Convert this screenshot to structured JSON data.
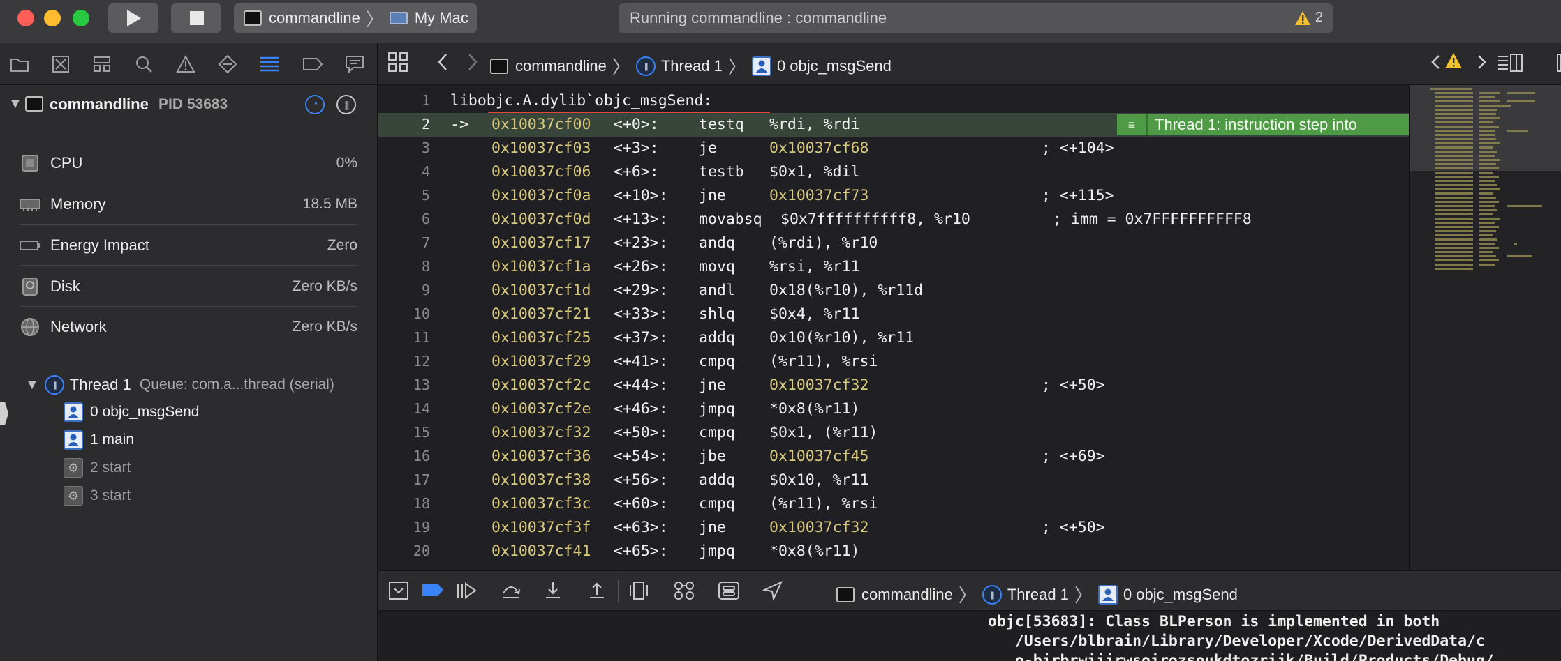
{
  "toolbar": {
    "scheme_target": "commandline",
    "scheme_device": "My Mac",
    "activity_text": "Running commandline : commandline",
    "warning_count": "2"
  },
  "navigator": {
    "process": {
      "name": "commandline",
      "pid": "PID 53683"
    },
    "gauges": [
      {
        "label": "CPU",
        "value": "0%",
        "icon": "cpu-icon"
      },
      {
        "label": "Memory",
        "value": "18.5 MB",
        "icon": "memory-icon"
      },
      {
        "label": "Energy Impact",
        "value": "Zero",
        "icon": "battery-icon"
      },
      {
        "label": "Disk",
        "value": "Zero KB/s",
        "icon": "disk-icon"
      },
      {
        "label": "Network",
        "value": "Zero KB/s",
        "icon": "network-icon"
      }
    ],
    "thread": {
      "name": "Thread 1",
      "queue": "Queue: com.a...thread (serial)"
    },
    "frames": [
      {
        "label": "0 objc_msgSend",
        "kind": "user"
      },
      {
        "label": "1 main",
        "kind": "user"
      },
      {
        "label": "2 start",
        "kind": "system"
      },
      {
        "label": "3 start",
        "kind": "system"
      }
    ]
  },
  "jumpbar": {
    "target": "commandline",
    "thread": "Thread 1",
    "frame": "0 objc_msgSend"
  },
  "editor": {
    "header_line": "libobjc.A.dylib`objc_msgSend:",
    "pc_arrow": "->",
    "breakpoint_message": "Thread 1: instruction step into",
    "lines": [
      {
        "n": "2",
        "addr": "0x10037cf00",
        "off": "<+0>:",
        "mn": "testq",
        "ops": "%rdi, %rdi",
        "comment": ""
      },
      {
        "n": "3",
        "addr": "0x10037cf03",
        "off": "<+3>:",
        "mn": "je",
        "ops": "0x10037cf68",
        "comment": "; <+104>"
      },
      {
        "n": "4",
        "addr": "0x10037cf06",
        "off": "<+6>:",
        "mn": "testb",
        "ops": "$0x1, %dil",
        "comment": ""
      },
      {
        "n": "5",
        "addr": "0x10037cf0a",
        "off": "<+10>:",
        "mn": "jne",
        "ops": "0x10037cf73",
        "comment": "; <+115>"
      },
      {
        "n": "6",
        "addr": "0x10037cf0d",
        "off": "<+13>:",
        "mn": "movabsq",
        "ops": "$0x7ffffffffff8, %r10",
        "comment": "; imm = 0x7FFFFFFFFFF8"
      },
      {
        "n": "7",
        "addr": "0x10037cf17",
        "off": "<+23>:",
        "mn": "andq",
        "ops": "(%rdi), %r10",
        "comment": ""
      },
      {
        "n": "8",
        "addr": "0x10037cf1a",
        "off": "<+26>:",
        "mn": "movq",
        "ops": "%rsi, %r11",
        "comment": ""
      },
      {
        "n": "9",
        "addr": "0x10037cf1d",
        "off": "<+29>:",
        "mn": "andl",
        "ops": "0x18(%r10), %r11d",
        "comment": ""
      },
      {
        "n": "10",
        "addr": "0x10037cf21",
        "off": "<+33>:",
        "mn": "shlq",
        "ops": "$0x4, %r11",
        "comment": ""
      },
      {
        "n": "11",
        "addr": "0x10037cf25",
        "off": "<+37>:",
        "mn": "addq",
        "ops": "0x10(%r10), %r11",
        "comment": ""
      },
      {
        "n": "12",
        "addr": "0x10037cf29",
        "off": "<+41>:",
        "mn": "cmpq",
        "ops": "(%r11), %rsi",
        "comment": ""
      },
      {
        "n": "13",
        "addr": "0x10037cf2c",
        "off": "<+44>:",
        "mn": "jne",
        "ops": "0x10037cf32",
        "comment": "; <+50>"
      },
      {
        "n": "14",
        "addr": "0x10037cf2e",
        "off": "<+46>:",
        "mn": "jmpq",
        "ops": "*0x8(%r11)",
        "comment": ""
      },
      {
        "n": "15",
        "addr": "0x10037cf32",
        "off": "<+50>:",
        "mn": "cmpq",
        "ops": "$0x1, (%r11)",
        "comment": ""
      },
      {
        "n": "16",
        "addr": "0x10037cf36",
        "off": "<+54>:",
        "mn": "jbe",
        "ops": "0x10037cf45",
        "comment": "; <+69>"
      },
      {
        "n": "17",
        "addr": "0x10037cf38",
        "off": "<+56>:",
        "mn": "addq",
        "ops": "$0x10, %r11",
        "comment": ""
      },
      {
        "n": "18",
        "addr": "0x10037cf3c",
        "off": "<+60>:",
        "mn": "cmpq",
        "ops": "(%r11), %rsi",
        "comment": ""
      },
      {
        "n": "19",
        "addr": "0x10037cf3f",
        "off": "<+63>:",
        "mn": "jne",
        "ops": "0x10037cf32",
        "comment": "; <+50>"
      },
      {
        "n": "20",
        "addr": "0x10037cf41",
        "off": "<+65>:",
        "mn": "jmpq",
        "ops": "*0x8(%r11)",
        "comment": ""
      }
    ]
  },
  "debugbar": {
    "target": "commandline",
    "thread": "Thread 1",
    "frame": "0 objc_msgSend"
  },
  "console": {
    "lines": [
      "objc[53683]: Class BLPerson is implemented in both",
      "   /Users/blbrain/Library/Developer/Xcode/DerivedData/c",
      "   o-birbrwiiirwsoirozsoukdtozrijk/Build/Products/Debug/"
    ]
  },
  "colors": {
    "accent": "#3a82f7",
    "current_line": "#37453a",
    "breakpoint_badge": "#4f9a45",
    "address_yellow": "#d9c97c",
    "underline_red": "#e0463a"
  }
}
